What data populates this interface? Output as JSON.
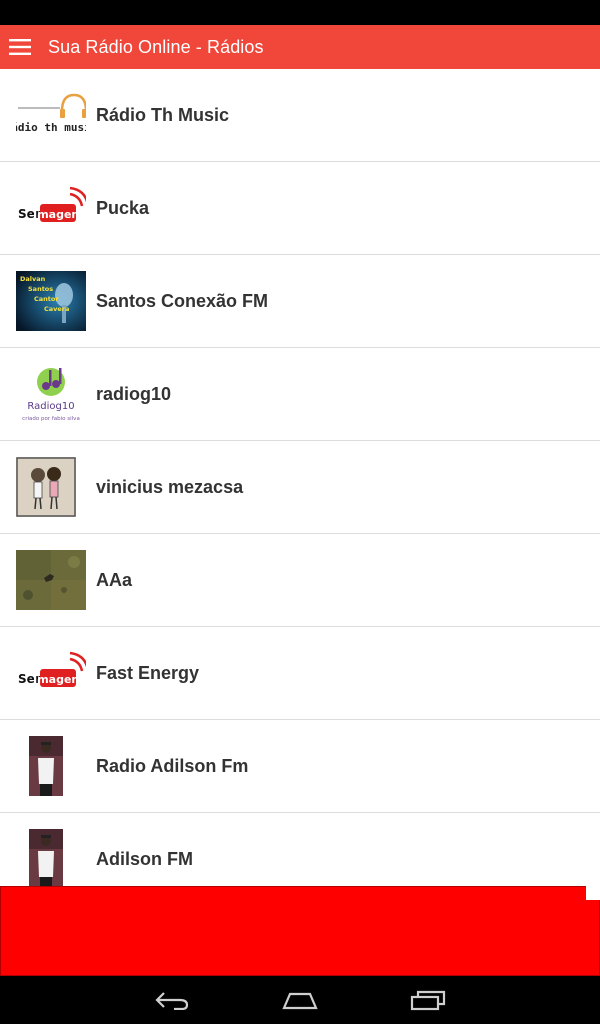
{
  "app_bar": {
    "title": "Sua Rádio Online - Rádios",
    "menu_icon": "hamburger-menu-icon",
    "bg_color": "#f0473a"
  },
  "stations": [
    {
      "name": "Rádio Th Music",
      "logo": "radio-th-music-logo",
      "logo_text": "rádio th music"
    },
    {
      "name": "Pucka",
      "logo": "sem-imagem-logo",
      "logo_text_1": "Sem",
      "logo_text_2": "Imagem"
    },
    {
      "name": "Santos Conexão FM",
      "logo": "santos-conexao-logo",
      "logo_text": "Dalvan Santos Cantor Cavera"
    },
    {
      "name": "radiog10",
      "logo": "radiog10-logo",
      "logo_text": "Radiog10",
      "logo_subtext": "criado por fabio silva"
    },
    {
      "name": "vinicius mezacsa",
      "logo": "couple-photo-thumbnail"
    },
    {
      "name": "AAa",
      "logo": "grass-photo-thumbnail"
    },
    {
      "name": "Fast Energy",
      "logo": "sem-imagem-logo",
      "logo_text_1": "Sem",
      "logo_text_2": "Imagem"
    },
    {
      "name": "Radio Adilson Fm",
      "logo": "person-photo-thumbnail"
    },
    {
      "name": "Adilson FM",
      "logo": "person-photo-thumbnail"
    }
  ],
  "ad_banner": {
    "color": "#ff0000"
  },
  "nav_bar": {
    "back_icon": "back-icon",
    "home_icon": "home-icon",
    "recents_icon": "recent-apps-icon"
  }
}
